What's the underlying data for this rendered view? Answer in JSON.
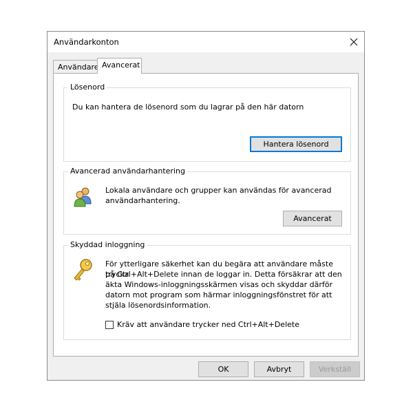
{
  "window": {
    "title": "Användarkonton"
  },
  "tabs": [
    {
      "label": "Användare",
      "active": false
    },
    {
      "label": "Avancerat",
      "active": true
    }
  ],
  "passwords": {
    "title": "Lösenord",
    "description": "Du kan hantera de lösenord som du lagrar på den här datorn",
    "button_label": "Hantera lösenord"
  },
  "advanced_user_mgmt": {
    "title": "Avancerad användarhantering",
    "description_line1": "Lokala användare och grupper kan användas för avancerad",
    "description_line2": "användarhantering.",
    "button_label": "Avancerat",
    "icon": "users-icon"
  },
  "secure_logon": {
    "title": "Skyddad inloggning",
    "lines": [
      "För ytterligare säkerhet kan du begära att användare måste trycka",
      "på Ctrl+Alt+Delete innan de loggar in. Detta försäkrar att den",
      "äkta Windows-inloggningsskärmen visas och skyddar därför",
      "datorn mot program som härmar inloggningsfönstret för att",
      "stjäla lösenordsinformation."
    ],
    "checkbox_label": "Kräv att användare trycker ned Ctrl+Alt+Delete",
    "checkbox_checked": false,
    "icon": "key-icon"
  },
  "footer": {
    "ok": "OK",
    "cancel": "Avbryt",
    "apply": "Verkställ"
  }
}
